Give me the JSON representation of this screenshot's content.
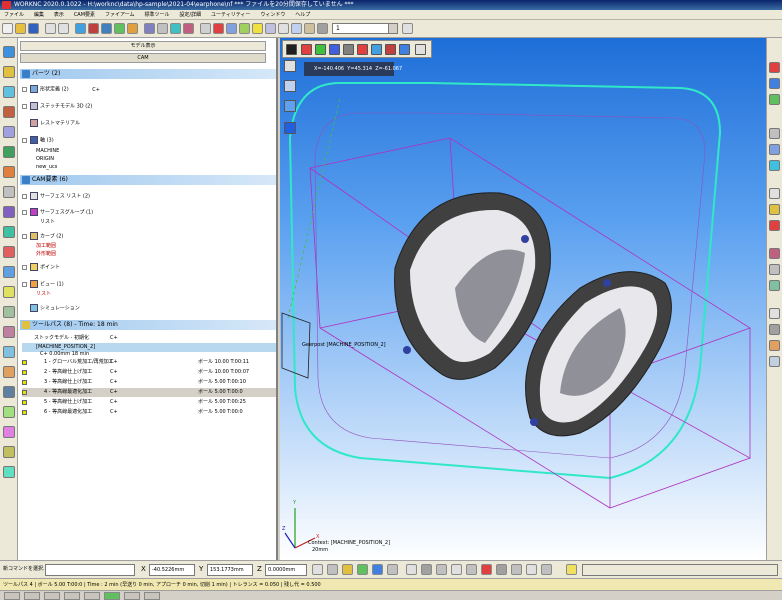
{
  "window": {
    "title": "WORKNC 2020.0.1022 - H:\\worknc\\data\\hp-sample\\2021-04\\earphone\\nf *** ファイルを20分間保存していません ***"
  },
  "menu": [
    "ファイル",
    "編集",
    "表示",
    "CAM要素",
    "ファイアーム",
    "標準ツール",
    "設定/詳細",
    "ユーティリティー",
    "ウィンドウ",
    "ヘルプ"
  ],
  "toolbar": {
    "combo_value": "1"
  },
  "panel": {
    "tab1_label": "モデル表示",
    "tab2_label": "CAM",
    "parts_header": "パーツ (2)",
    "cam_header": "CAM要素 (6)",
    "toolpath_header": "ツールパス (8) - Time: 18 min",
    "part_nodes": [
      {
        "label": "形状定義 (2)",
        "suffix": "C+"
      },
      {
        "label": "ステッチモデル 3D (2)",
        "suffix": ""
      },
      {
        "label": "レストマテリアル",
        "suffix": ""
      },
      {
        "label": "軸 (3)",
        "suffix": ""
      }
    ],
    "axis_children": [
      "MACHINE",
      "ORIGIN",
      "new_ucs"
    ],
    "cam_nodes": [
      {
        "label": "サーフェス リスト (2)"
      },
      {
        "label": "サーフェスグループ (1)"
      },
      {
        "label": "リスト"
      },
      {
        "label": "カーブ (2)"
      },
      {
        "label": "ポイント"
      },
      {
        "label": "ビュー (1)"
      },
      {
        "label": "シミュレーション"
      }
    ],
    "curve_children": [
      "加工範囲",
      "外形範囲"
    ],
    "view_child": "リスト",
    "toolpath_pre": "ストックモデル - 初期化",
    "toolpath_pre_suffix": "C+",
    "machine_position": "[MACHINE_POSITION_2]",
    "machine_sub": "C+ 0.00mm 18 min",
    "operations": [
      {
        "name": "1 - グローバル荒加工/再荒加工",
        "cond": "C+",
        "tool": "ボール 10.00 T:00:11"
      },
      {
        "name": "2 - 等高線仕上げ加工",
        "cond": "C+",
        "tool": "ボール 10.00 T:00:07"
      },
      {
        "name": "3 - 等高線仕上げ加工",
        "cond": "C+",
        "tool": "ボール 5.00 T:00:10"
      },
      {
        "name": "4 - 等高線最適化加工",
        "cond": "C+",
        "tool": "ボール 5.00 T:00:0"
      },
      {
        "name": "5 - 等高線仕上げ加工",
        "cond": "C+",
        "tool": "ボール 5.00 T:00:25"
      },
      {
        "name": "6 - 等高線最適化加工",
        "cond": "C+",
        "tool": "ボール 5.00 T:00:0"
      }
    ]
  },
  "viewport": {
    "coords": {
      "x": "X=-140.406",
      "y": "Y=45.314",
      "z": "Z=-61.067"
    },
    "ucs_label": "Geerpost [MACHINE_POSITION_2]",
    "bottom_label_1": "Context: [MACHINE_POSITION_2]",
    "bottom_label_2": "20mm",
    "axis_labels": {
      "x": "X",
      "y": "Y",
      "z": "Z"
    }
  },
  "inputbar": {
    "command_label": "新コマンドを選択...",
    "x_label": "X",
    "x_value": "-40.5226mm",
    "y_label": "Y",
    "y_value": "153.1773mm",
    "z_label": "Z",
    "z_value": "0.0000mm"
  },
  "statusbar": {
    "text": "ツールパス 4 | ボール 5.00 T:00:0 | Time : 2 min (早送り 0 min, アプローチ 0 min, 切削 1 min) | トレランス = 0.050 | 残し代 = 0.500"
  },
  "colors": {
    "viewport_top": "#1e6ed8",
    "stock_box": "#40e0c0",
    "limit_box": "#c040c0",
    "mesh": "#303030"
  }
}
